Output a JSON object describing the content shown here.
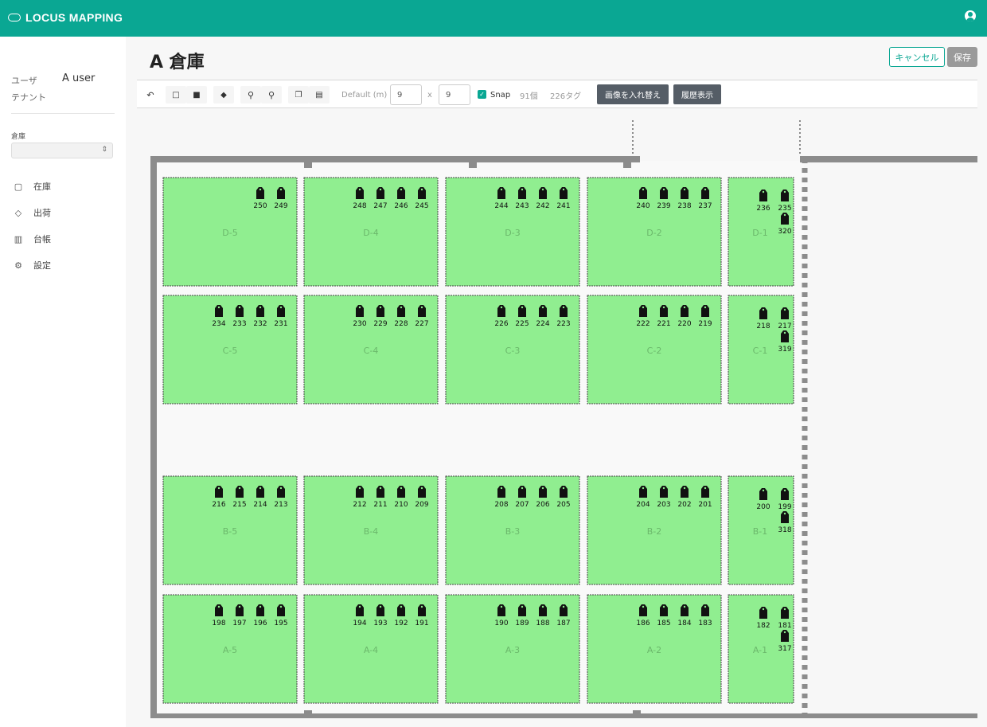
{
  "app": {
    "brand": "LOCUS MAPPING"
  },
  "sidebar": {
    "user_label": "ユーザ",
    "user_value": "A user",
    "tenant_label": "テナント",
    "warehouse_label": "倉庫",
    "warehouse_value": "",
    "nav": [
      {
        "label": "在庫",
        "icon": "box-icon"
      },
      {
        "label": "出荷",
        "icon": "tag-icon"
      },
      {
        "label": "台帳",
        "icon": "book-icon"
      },
      {
        "label": "設定",
        "icon": "gear-icon"
      }
    ]
  },
  "page": {
    "title": "A 倉庫",
    "cancel_label": "キャンセル",
    "save_label": "保存"
  },
  "toolbar": {
    "default_label": "Default (m)",
    "width_value": "9",
    "times": "x",
    "height_value": "9",
    "snap_label": "Snap",
    "count_label": "91個",
    "tags_label": "226タグ",
    "replace_image_label": "画像を入れ替え",
    "history_label": "履歴表示"
  },
  "map": {
    "rack_color": "#90ee90",
    "rows": [
      {
        "cells": [
          {
            "label": "D-5",
            "tags": [
              "250",
              "249"
            ]
          },
          {
            "label": "D-4",
            "tags": [
              "248",
              "247",
              "246",
              "245"
            ]
          },
          {
            "label": "D-3",
            "tags": [
              "244",
              "243",
              "242",
              "241"
            ]
          },
          {
            "label": "D-2",
            "tags": [
              "240",
              "239",
              "238",
              "237"
            ]
          },
          {
            "label": "D-1",
            "tags": [
              "236",
              "235",
              "320"
            ]
          }
        ]
      },
      {
        "cells": [
          {
            "label": "C-5",
            "tags": [
              "234",
              "233",
              "232",
              "231"
            ]
          },
          {
            "label": "C-4",
            "tags": [
              "230",
              "229",
              "228",
              "227"
            ]
          },
          {
            "label": "C-3",
            "tags": [
              "226",
              "225",
              "224",
              "223"
            ]
          },
          {
            "label": "C-2",
            "tags": [
              "222",
              "221",
              "220",
              "219"
            ]
          },
          {
            "label": "C-1",
            "tags": [
              "218",
              "217",
              "319"
            ]
          }
        ]
      },
      {
        "cells": [
          {
            "label": "B-5",
            "tags": [
              "216",
              "215",
              "214",
              "213"
            ]
          },
          {
            "label": "B-4",
            "tags": [
              "212",
              "211",
              "210",
              "209"
            ]
          },
          {
            "label": "B-3",
            "tags": [
              "208",
              "207",
              "206",
              "205"
            ]
          },
          {
            "label": "B-2",
            "tags": [
              "204",
              "203",
              "202",
              "201"
            ]
          },
          {
            "label": "B-1",
            "tags": [
              "200",
              "199",
              "318"
            ]
          }
        ]
      },
      {
        "cells": [
          {
            "label": "A-5",
            "tags": [
              "198",
              "197",
              "196",
              "195"
            ]
          },
          {
            "label": "A-4",
            "tags": [
              "194",
              "193",
              "192",
              "191"
            ]
          },
          {
            "label": "A-3",
            "tags": [
              "190",
              "189",
              "188",
              "187"
            ]
          },
          {
            "label": "A-2",
            "tags": [
              "186",
              "185",
              "184",
              "183"
            ]
          },
          {
            "label": "A-1",
            "tags": [
              "182",
              "181",
              "317"
            ]
          }
        ]
      }
    ]
  }
}
